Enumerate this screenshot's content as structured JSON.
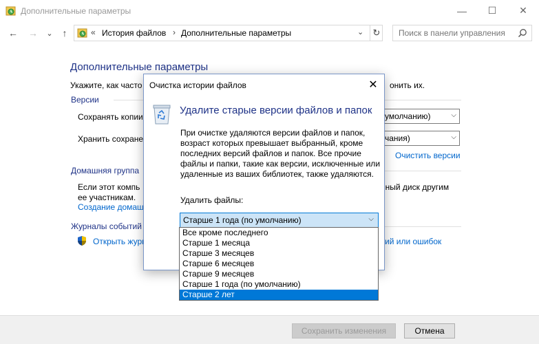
{
  "window": {
    "title": "Дополнительные параметры",
    "minimize_glyph": "—",
    "maximize_glyph": "☐",
    "close_glyph": "✕"
  },
  "nav": {
    "back_glyph": "←",
    "forward_glyph": "→",
    "recent_glyph": "⌄",
    "up_glyph": "↑"
  },
  "address": {
    "overflow": "«",
    "crumbs": [
      "История файлов",
      "Дополнительные параметры"
    ],
    "separator": "›",
    "dropdown_glyph": "⌄",
    "refresh_glyph": "↻"
  },
  "search": {
    "placeholder": "Поиск в панели управления"
  },
  "page": {
    "heading": "Дополнительные параметры",
    "intro_left": "Укажите, как часто",
    "intro_right": "онить их.",
    "versions_section": "Версии",
    "save_copies_label": "Сохранять копии",
    "save_copies_value": "умолчанию)",
    "keep_saved_label": "Хранить сохранен",
    "keep_saved_value": "чания)",
    "cleanup_link": "Очистить версии",
    "homegroup_section": "Домашняя группа",
    "homegroup_text_1": "Если этот компь",
    "homegroup_text_1_right": "нный диск другим",
    "homegroup_text_2": "ее участникам.",
    "homegroup_link": "Создание домаш",
    "eventlog_section": "Журналы событий",
    "eventlog_link": "Открыть журн",
    "eventlog_link_right": "ий или ошибок"
  },
  "buttons": {
    "save": "Сохранить изменения",
    "cancel": "Отмена"
  },
  "dialog": {
    "title": "Очистка истории файлов",
    "close_glyph": "✕",
    "heading": "Удалите старые версии файлов и папок",
    "body": "При очистке удаляются версии файлов и папок, возраст которых превышает выбранный, кроме последних версий файлов и папок. Все прочие файлы и папки, такие как версии, исключенные или удаленные из ваших библиотек, также удаляются.",
    "delete_label": "Удалить файлы:",
    "selected": "Старше 1 года (по умолчанию)",
    "options": [
      "Все кроме последнего",
      "Старше 1 месяца",
      "Старше 3 месяцев",
      "Старше 6 месяцев",
      "Старше 9 месяцев",
      "Старше 1 года (по умолчанию)",
      "Старше 2 лет"
    ],
    "highlighted_option": "Старше 2 лет"
  },
  "icons": {
    "app": "file-history-icon",
    "bin": "recycle-bin-icon",
    "shield": "uac-shield-icon",
    "search": "search-icon"
  },
  "colors": {
    "heading_blue": "#1e3287",
    "link_blue": "#0066cc",
    "highlight": "#0078d7"
  }
}
